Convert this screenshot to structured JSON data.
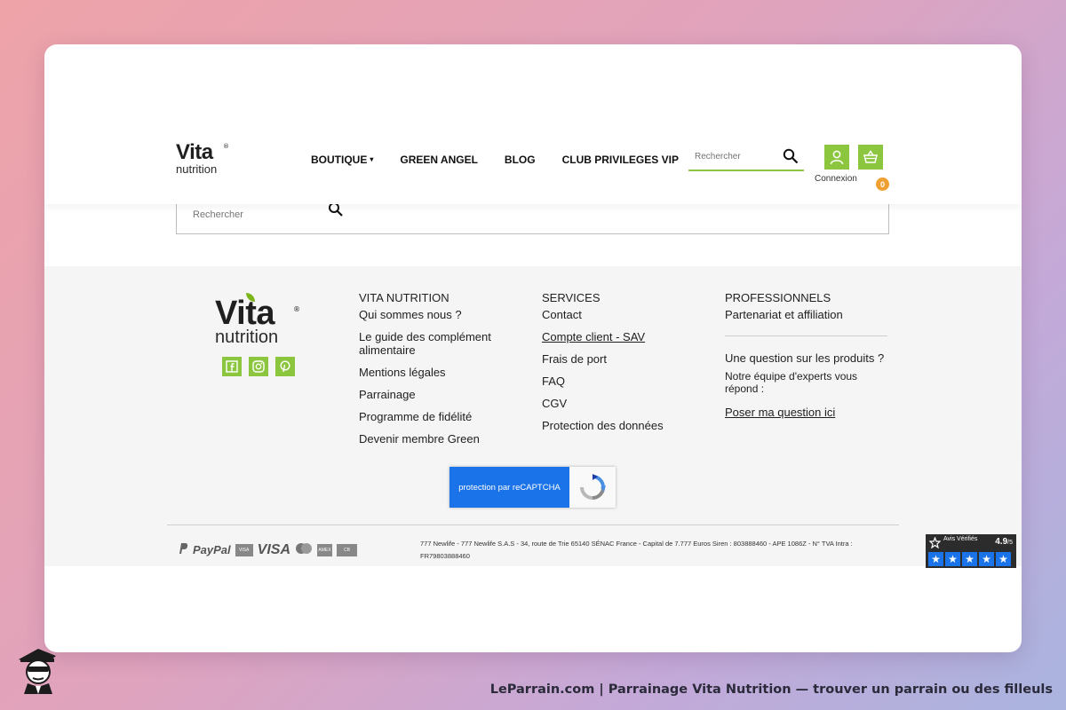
{
  "brand": {
    "logo_top": "Vita",
    "logo_bottom": "nutrition",
    "registered": "®"
  },
  "nav": {
    "items": [
      {
        "label": "BOUTIQUE",
        "has_dropdown": true
      },
      {
        "label": "GREEN ANGEL"
      },
      {
        "label": "BLOG"
      },
      {
        "label": "CLUB PRIVILEGES VIP"
      }
    ],
    "caret": "▾"
  },
  "header_search": {
    "placeholder": "Rechercher"
  },
  "account": {
    "label": "Connexion",
    "icon": "user-icon"
  },
  "cart": {
    "count": "0",
    "icon": "basket-icon"
  },
  "page_search": {
    "placeholder": "Rechercher"
  },
  "footer": {
    "social": [
      "facebook-icon",
      "instagram-icon",
      "pinterest-icon"
    ],
    "col_vita": {
      "title": "VITA NUTRITION",
      "links": [
        "Qui sommes nous ?",
        "Le guide des complément alimentaire",
        "Mentions légales",
        "Parrainage",
        "Programme de fidélité",
        "Devenir membre Green"
      ]
    },
    "col_services": {
      "title": "SERVICES",
      "links": [
        "Contact",
        "Compte client - SAV",
        "Frais de port",
        "FAQ",
        "CGV",
        "Protection des données"
      ]
    },
    "col_pro": {
      "title": "PROFESSIONNELS",
      "link": "Partenariat et affiliation",
      "question": "Une question sur les produits ?",
      "team": "Notre équipe d'experts vous répond :",
      "ask": "Poser ma question ici"
    },
    "recaptcha": "protection par reCAPTCHA",
    "payments": {
      "paypal": "PayPal",
      "visa": "VISA",
      "badges": [
        "VISA",
        "MC",
        "AMEX",
        "CB"
      ]
    },
    "legal": "777 Newlife - 777 Newlife S.A.S - 34, route de Trie 65140 SÉNAC France - Capital de 7.777 Euros Siren : 803888460 - APE 1086Z - N° TVA Intra : FR79803888460",
    "avis": {
      "label": "Avis Vérifiés",
      "score": "4.9",
      "max": "/5",
      "star": "★"
    }
  },
  "caption": "LeParrain.com | Parrainage Vita Nutrition — trouver un parrain ou des filleuls",
  "colors": {
    "accent": "#8cc63f",
    "badge": "#f0a030",
    "recaptcha": "#1a73e8"
  }
}
